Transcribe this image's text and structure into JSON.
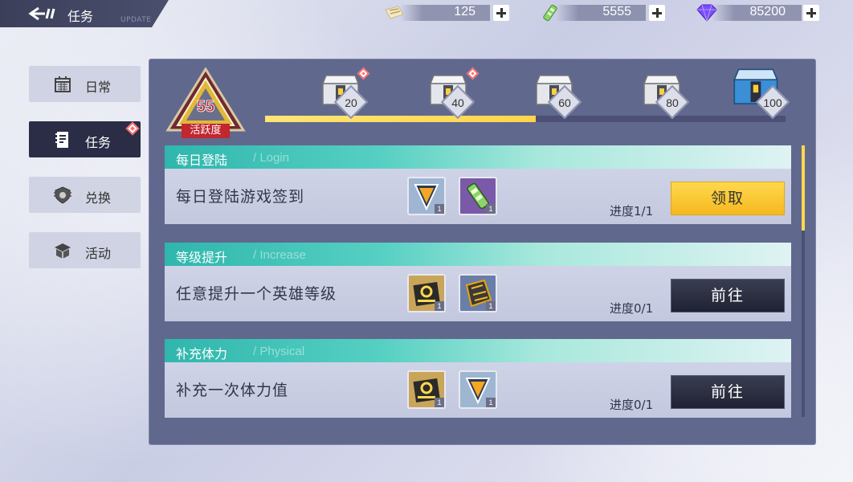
{
  "header": {
    "title": "任务",
    "subtitle": "UPDATE",
    "back_icon": "back-arrow-icon"
  },
  "resources": [
    {
      "icon": "ticket-icon",
      "value": "125"
    },
    {
      "icon": "energy-battery-icon",
      "value": "5555"
    },
    {
      "icon": "diamond-icon",
      "value": "85200"
    }
  ],
  "sidebar": {
    "items": [
      {
        "label": "日常",
        "icon": "calendar-icon",
        "active": false
      },
      {
        "label": "任务",
        "icon": "task-card-icon",
        "active": true
      },
      {
        "label": "兑换",
        "icon": "shield-exchange-icon",
        "active": false
      },
      {
        "label": "活动",
        "icon": "gift-box-icon",
        "active": false
      }
    ]
  },
  "activity": {
    "value": "55",
    "label": "活跃度",
    "max": 100,
    "progress_value": 55,
    "milestones": [
      "20",
      "40",
      "60",
      "80",
      "100"
    ]
  },
  "tasks": [
    {
      "category": "每日登陆",
      "category_en": "/ Login",
      "desc": "每日登陆游戏签到",
      "rewards": [
        "1",
        "1"
      ],
      "progress": "进度1/1",
      "button": "领取"
    },
    {
      "category": "等级提升",
      "category_en": "/ Increase",
      "desc": "任意提升一个英雄等级",
      "rewards": [
        "1",
        "1"
      ],
      "progress": "进度0/1",
      "button": "前往"
    },
    {
      "category": "补充体力",
      "category_en": "/ Physical",
      "desc": "补充一次体力值",
      "rewards": [
        "1",
        "1"
      ],
      "progress": "进度0/1",
      "button": "前往"
    }
  ],
  "colors": {
    "accent_yellow": "#ffd84d",
    "panel_bg": "#61688e",
    "task_header_teal": "#2fb6ad",
    "badge_red": "#c2262f"
  }
}
